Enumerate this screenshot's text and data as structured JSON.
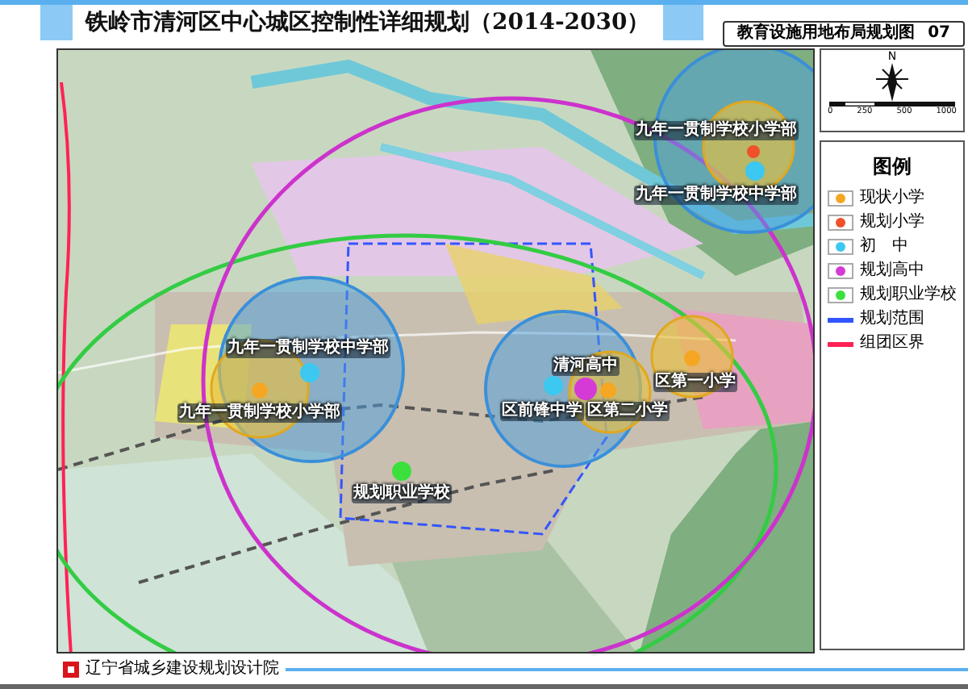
{
  "title": "铁岭市清河区中心城区控制性详细规划（2014-2030）",
  "sheet": {
    "name": "教育设施用地布局规划图",
    "number": "07"
  },
  "compass": {
    "north": "N",
    "scale": [
      "0",
      "250",
      "500",
      "1000"
    ]
  },
  "legend": {
    "title": "图例",
    "items": [
      {
        "kind": "dot",
        "label": "现状小学",
        "color": "#f5a623"
      },
      {
        "kind": "dot",
        "label": "规划小学",
        "color": "#f0502a"
      },
      {
        "kind": "dot",
        "label": "初　中",
        "color": "#3cc8f0"
      },
      {
        "kind": "dot",
        "label": "规划高中",
        "color": "#d63ad6"
      },
      {
        "kind": "dot",
        "label": "规划职业学校",
        "color": "#3ce03c"
      },
      {
        "kind": "line",
        "label": "规划范围",
        "color": "#3355ff"
      },
      {
        "kind": "line",
        "label": "组团区界",
        "color": "#ff2255"
      }
    ]
  },
  "map": {
    "markers": [
      {
        "color": "#f0502a"
      },
      {
        "color": "#3cc8f0"
      },
      {
        "color": "#f5a623"
      },
      {
        "color": "#3cc8f0"
      },
      {
        "color": "#3ce03c"
      },
      {
        "color": "#d63ad6"
      },
      {
        "color": "#3cc8f0"
      },
      {
        "color": "#f5a623"
      },
      {
        "color": "#f5a623"
      }
    ],
    "labels": [
      "九年一贯制学校小学部",
      "九年一贯制学校中学部",
      "九年一贯制学校中学部",
      "九年一贯制学校小学部",
      "规划职业学校",
      "清河高中",
      "区前锋中学",
      "区第二小学",
      "区第一小学"
    ]
  },
  "footer": {
    "org": "辽宁省城乡建设规划设计院"
  }
}
